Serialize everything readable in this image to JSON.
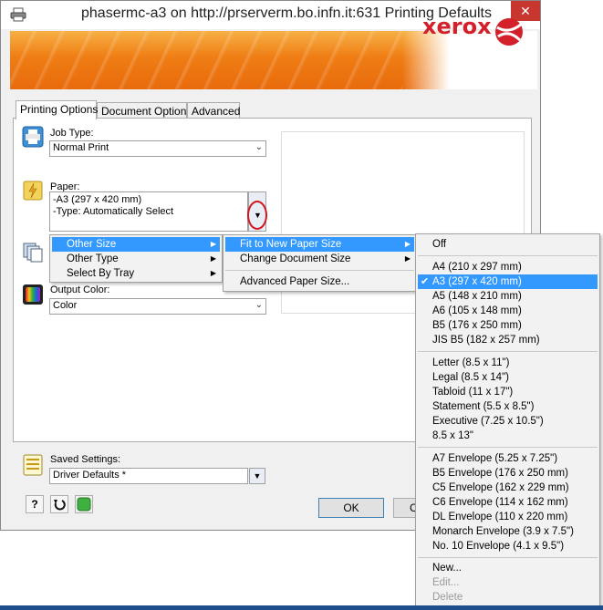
{
  "window": {
    "title": "phasermc-a3 on http://prserverm.bo.infn.it:631 Printing Defaults",
    "close_label": "✕"
  },
  "brand": {
    "name": "xerox",
    "registered": "®"
  },
  "tabs": [
    {
      "label": "Printing Options",
      "active": true
    },
    {
      "label": "Document Options",
      "active": false
    },
    {
      "label": "Advanced",
      "active": false
    }
  ],
  "job_type": {
    "label": "Job Type:",
    "value": "Normal Print"
  },
  "paper": {
    "label": "Paper:",
    "line1": "-A3 (297 x 420 mm)",
    "line2": "-Type: Automatically Select"
  },
  "output_color": {
    "label": "Output Color:",
    "value": "Color"
  },
  "paper_menu": {
    "items": [
      {
        "label": "Other Size",
        "highlighted": true
      },
      {
        "label": "Other Type",
        "highlighted": false
      },
      {
        "label": "Select By Tray",
        "highlighted": false
      }
    ]
  },
  "size_menu": {
    "items": [
      {
        "label": "Fit to New Paper Size",
        "highlighted": true
      },
      {
        "label": "Change Document Size",
        "highlighted": false
      }
    ],
    "advanced": "Advanced Paper Size..."
  },
  "paper_sizes": {
    "off": "Off",
    "group1": [
      "A4 (210 x 297 mm)",
      "A3 (297 x 420 mm)",
      "A5 (148 x 210 mm)",
      "A6 (105 x 148 mm)",
      "B5 (176 x 250 mm)",
      "JIS B5 (182 x 257 mm)"
    ],
    "selected": "A3 (297 x 420 mm)",
    "group2": [
      "Letter (8.5 x 11\")",
      "Legal (8.5 x 14\")",
      "Tabloid (11 x 17\")",
      "Statement (5.5 x 8.5\")",
      "Executive (7.25 x 10.5\")",
      "8.5 x 13\""
    ],
    "group3": [
      "A7 Envelope (5.25 x 7.25\")",
      "B5 Envelope (176 x 250 mm)",
      "C5 Envelope (162 x 229 mm)",
      "C6 Envelope (114 x 162 mm)",
      "DL Envelope (110 x 220 mm)",
      "Monarch Envelope (3.9 x 7.5\")",
      "No. 10 Envelope (4.1 x 9.5\")"
    ],
    "new": "New...",
    "edit": "Edit...",
    "delete": "Delete"
  },
  "saved_settings": {
    "label": "Saved Settings:",
    "value": "Driver Defaults *"
  },
  "buttons": {
    "ok": "OK",
    "cancel_partial": "C",
    "help": "?"
  }
}
